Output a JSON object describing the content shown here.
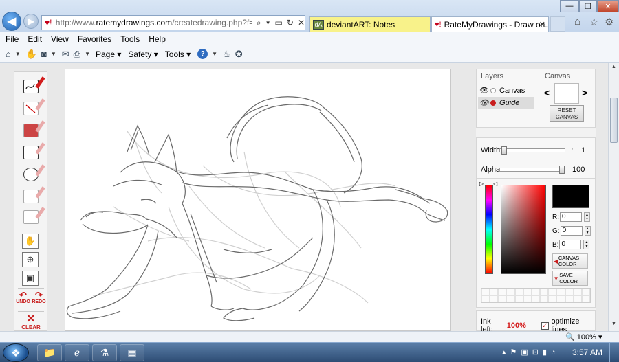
{
  "browser": {
    "address_favicon": "♥!",
    "url_prefix": "http://www.",
    "url_domain": "ratemydrawings.com",
    "url_rest": "/createdrawing.php?f=l&s=",
    "tabs": [
      {
        "label": "deviantART: Notes",
        "favicon": "dA"
      },
      {
        "label": "RateMyDrawings - Draw on...",
        "favicon": "♥!"
      }
    ],
    "tab_close": "✕",
    "window_controls": {
      "minimize": "—",
      "maximize": "❐",
      "close": "✕"
    },
    "right_icons": [
      "home-icon",
      "favorites-star-icon",
      "tools-gear-icon"
    ]
  },
  "menu": {
    "items": [
      "File",
      "Edit",
      "View",
      "Favorites",
      "Tools",
      "Help"
    ]
  },
  "command_bar": {
    "page": "Page",
    "safety": "Safety",
    "tools": "Tools",
    "help": "?"
  },
  "app": {
    "layers_heading": "Layers",
    "canvas_heading": "Canvas",
    "layers": [
      {
        "name": "Canvas",
        "dot_color": "#ffffff"
      },
      {
        "name": "Guide",
        "dot_color": "#c81c1c",
        "selected": true
      }
    ],
    "canvas_prev": "<",
    "canvas_next": ">",
    "reset_canvas": "RESET CANVAS",
    "width_label": "Width",
    "width_value": "1",
    "width_level": 0.02,
    "alpha_label": "Alpha",
    "alpha_value": "100",
    "alpha_level": 1.0,
    "current_color": "#000000",
    "r_label": "R:",
    "g_label": "G:",
    "b_label": "B:",
    "r_value": "0",
    "g_value": "0",
    "b_value": "0",
    "canvas_color_btn": "CANVAS COLOR",
    "save_color_btn": "SAVE COLOR",
    "ink_label": "Ink left:",
    "ink_value": "100%",
    "optimize_label": "optimize lines",
    "optimize_checked": true,
    "undo": "UNDO",
    "redo": "REDO",
    "clear": "CLEAR",
    "accent_color": "#c81c1c"
  },
  "status": {
    "zoom": "100%"
  },
  "taskbar": {
    "clock": "3:57 AM",
    "pinned": [
      "explorer-folder-icon",
      "internet-explorer-icon",
      "app-icon",
      "photos-icon"
    ]
  }
}
